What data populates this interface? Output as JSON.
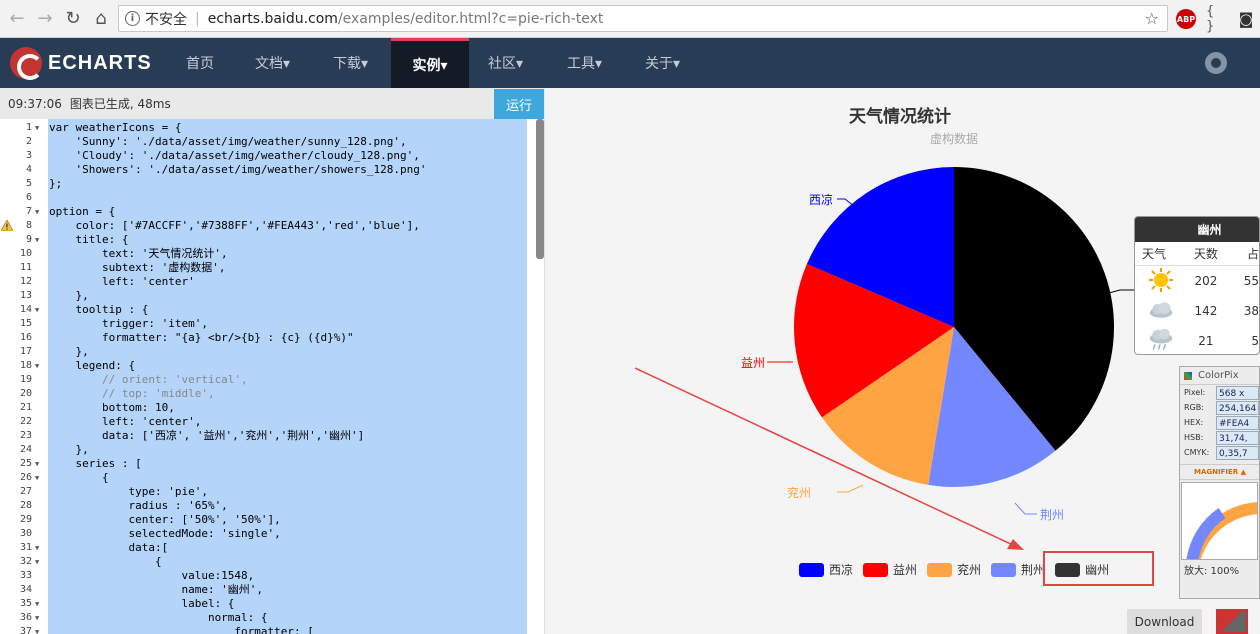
{
  "browser": {
    "insecure_label": "不安全",
    "url_host": "echarts.baidu.com",
    "url_path": "/examples/editor.html?c=pie-rich-text"
  },
  "nav": {
    "logo": "ECHARTS",
    "items": [
      "首页",
      "文档▾",
      "下载▾",
      "实例▾",
      "社区▾",
      "工具▾",
      "关于▾"
    ],
    "active_index": 3
  },
  "editor": {
    "status_time": "09:37:06",
    "status_msg": "图表已生成, 48ms",
    "run_label": "运行",
    "lines": [
      "var weatherIcons = {",
      "    'Sunny': './data/asset/img/weather/sunny_128.png',",
      "    'Cloudy': './data/asset/img/weather/cloudy_128.png',",
      "    'Showers': './data/asset/img/weather/showers_128.png'",
      "};",
      "",
      "option = {",
      "    color: ['#7ACCFF','#7388FF','#FEA443','red','blue'],",
      "    title: {",
      "        text: '天气情况统计',",
      "        subtext: '虚构数据',",
      "        left: 'center'",
      "    },",
      "    tooltip : {",
      "        trigger: 'item',",
      "        formatter: \"{a} <br/>{b} : {c} ({d}%)\"",
      "    },",
      "    legend: {",
      "        // orient: 'vertical',",
      "        // top: 'middle',",
      "        bottom: 10,",
      "        left: 'center',",
      "        data: ['西凉', '益州','兖州','荆州','幽州']",
      "    },",
      "    series : [",
      "        {",
      "            type: 'pie',",
      "            radius : '65%',",
      "            center: ['50%', '50%'],",
      "            selectedMode: 'single',",
      "            data:[",
      "                {",
      "                    value:1548,",
      "                    name: '幽州',",
      "                    label: {",
      "                        normal: {",
      "                            formatter: ["
    ]
  },
  "chart_data": {
    "type": "pie",
    "title": "天气情况统计",
    "subtitle": "虚构数据",
    "slices": [
      {
        "name": "幽州",
        "value": 1548,
        "color": "#000000"
      },
      {
        "name": "荆州",
        "value": 535,
        "color": "#7388FF"
      },
      {
        "name": "兖州",
        "value": 510,
        "color": "#FEA443"
      },
      {
        "name": "益州",
        "value": 634,
        "color": "#ff0000"
      },
      {
        "name": "西凉",
        "value": 735,
        "color": "#0000ff"
      }
    ],
    "legend": {
      "placement": "bottom-center",
      "items": [
        {
          "name": "西凉",
          "color": "#0000ff"
        },
        {
          "name": "益州",
          "color": "#ff0000"
        },
        {
          "name": "兖州",
          "color": "#FEA443"
        },
        {
          "name": "荆州",
          "color": "#7388FF"
        },
        {
          "name": "幽州",
          "color": "#333333"
        }
      ]
    }
  },
  "tooltip": {
    "title": "幽州",
    "cols": [
      "天气",
      "天数",
      "占"
    ],
    "rows": [
      {
        "icon": "sunny-icon",
        "days": "202",
        "pct": "55"
      },
      {
        "icon": "cloudy-icon",
        "days": "142",
        "pct": "38"
      },
      {
        "icon": "showers-icon",
        "days": "21",
        "pct": "5"
      }
    ]
  },
  "colorpix": {
    "title": "ColorPix",
    "rows": [
      {
        "label": "Pixel:",
        "value": "568 x"
      },
      {
        "label": "RGB:",
        "value": "254,164"
      },
      {
        "label": "HEX:",
        "value": "#FEA4"
      },
      {
        "label": "HSB:",
        "value": "31,74,"
      },
      {
        "label": "CMYK:",
        "value": "0,35,7"
      }
    ],
    "magnifier_label": "MAGNIFIER ▲",
    "zoom": "放大: 100%"
  },
  "actions": {
    "download": "Download"
  }
}
